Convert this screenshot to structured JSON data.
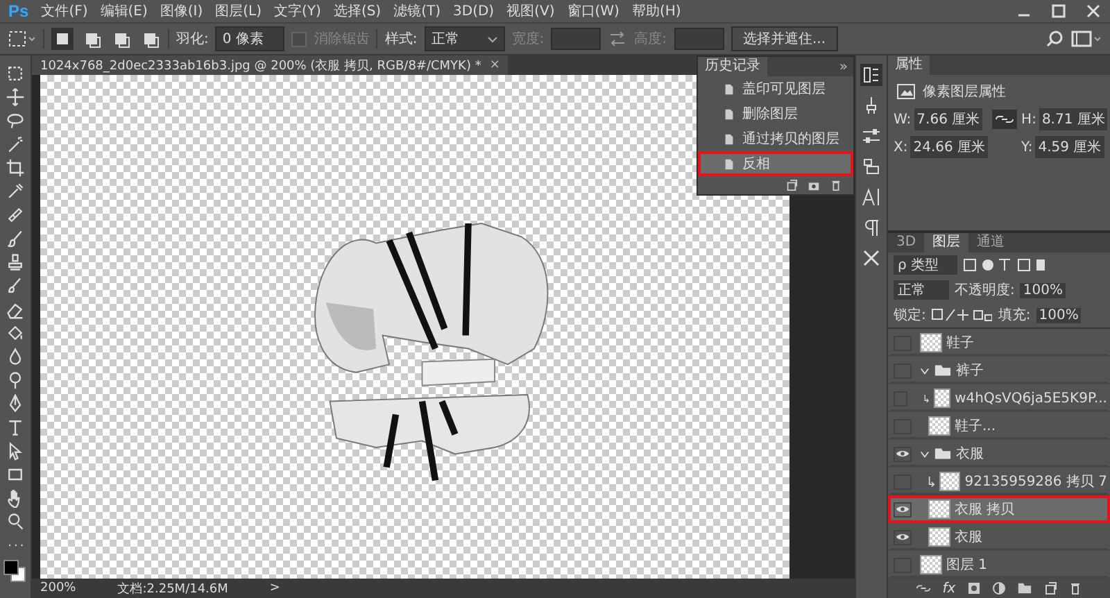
{
  "app_logo": "Ps",
  "menu": [
    "文件(F)",
    "编辑(E)",
    "图像(I)",
    "图层(L)",
    "文字(Y)",
    "选择(S)",
    "滤镜(T)",
    "3D(D)",
    "视图(V)",
    "窗口(W)",
    "帮助(H)"
  ],
  "options_bar": {
    "selection_modes": [
      {
        "selected": true
      },
      {
        "selected": false
      },
      {
        "selected": false
      },
      {
        "selected": false
      }
    ],
    "feather_label": "羽化:",
    "feather_value": "0 像素",
    "antialias": {
      "label": "消除锯齿",
      "checked": false,
      "disabled": true
    },
    "style_label": "样式:",
    "style_value": "正常",
    "width_label": "宽度:",
    "height_label": "高度:",
    "refine_button": "选择并遮住..."
  },
  "document_tab": {
    "title": "1024x768_2d0ec2333ab16b3.jpg @ 200% (衣服 拷贝, RGB/8#/CMYK) *",
    "close": "×"
  },
  "history": {
    "title": "历史记录",
    "menu_glyph": "»",
    "items": [
      {
        "label": "盖印可见图层",
        "selected": false,
        "highlighted": false
      },
      {
        "label": "删除图层",
        "selected": false,
        "highlighted": false
      },
      {
        "label": "通过拷贝的图层",
        "selected": false,
        "highlighted": false
      },
      {
        "label": "反相",
        "selected": true,
        "highlighted": true
      }
    ]
  },
  "properties": {
    "title": "属性",
    "subtitle": "像素图层属性",
    "fields": [
      {
        "label": "W:",
        "value": "7.66 厘米"
      },
      {
        "label": "H:",
        "value": "8.71 厘米"
      },
      {
        "label": "X:",
        "value": "24.66 厘米"
      },
      {
        "label": "Y:",
        "value": "4.59 厘米"
      }
    ]
  },
  "layers_panel": {
    "tabs": [
      {
        "label": "3D",
        "selected": false
      },
      {
        "label": "图层",
        "selected": true
      },
      {
        "label": "通道",
        "selected": false
      }
    ],
    "filter": "ρ 类型",
    "blend_mode": "正常",
    "opacity_label": "不透明度:",
    "opacity": "100%",
    "lock_label": "锁定:",
    "fill_label": "填充:",
    "fill": "100%",
    "fx": "fx",
    "layers": [
      {
        "name": "鞋子",
        "kind": "layer",
        "visible": false,
        "selected": false,
        "highlighted": false,
        "clipped": false
      },
      {
        "name": "裤子",
        "kind": "group",
        "visible": false,
        "selected": false,
        "highlighted": false,
        "expanded": true,
        "children": [
          {
            "name": "w4hQsVQ6ja5E5K9P...",
            "kind": "layer",
            "visible": false,
            "selected": false,
            "highlighted": false,
            "clipped": true
          },
          {
            "name": "鞋子...",
            "kind": "layer",
            "visible": false,
            "selected": false,
            "highlighted": false,
            "clipped": false
          }
        ]
      },
      {
        "name": "衣服",
        "kind": "group",
        "visible": true,
        "selected": false,
        "highlighted": false,
        "expanded": true,
        "children": [
          {
            "name": "92135959286 拷贝 7",
            "kind": "layer",
            "visible": false,
            "selected": false,
            "highlighted": false,
            "clipped": true
          },
          {
            "name": "衣服 拷贝",
            "kind": "layer",
            "visible": true,
            "selected": true,
            "highlighted": true,
            "clipped": false
          },
          {
            "name": "衣服",
            "kind": "layer",
            "visible": true,
            "selected": false,
            "highlighted": false,
            "clipped": false
          }
        ]
      },
      {
        "name": "图层 1",
        "kind": "layer",
        "visible": false,
        "selected": false,
        "highlighted": false,
        "clipped": false
      }
    ]
  },
  "status_bar": {
    "zoom": "200%",
    "doc_info": "文档:2.25M/14.6M",
    "arrow": ">"
  }
}
